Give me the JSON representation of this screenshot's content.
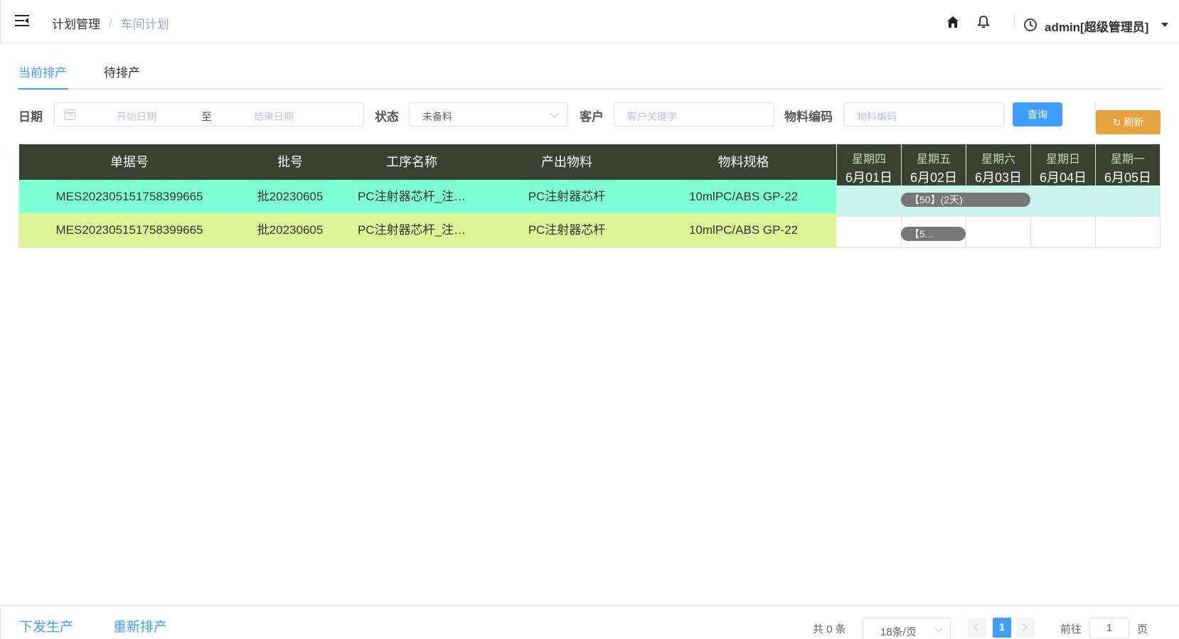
{
  "header": {
    "breadcrumb": [
      "计划管理",
      "车间计划"
    ],
    "separator": "/",
    "username": "admin[超级管理员]"
  },
  "tabs": [
    "当前排产",
    "待排产"
  ],
  "filters": {
    "date_label": "日期",
    "start_placeholder": "开始日期",
    "range_separator": "至",
    "end_placeholder": "结束日期",
    "status_label": "状态",
    "status_value": "未备料",
    "customer_label": "客户",
    "customer_placeholder": "客户关键字",
    "material_label": "物料编码",
    "material_placeholder": "物料编码",
    "query_button": "查询",
    "refresh_button": "刷新"
  },
  "table": {
    "columns": [
      "单据号",
      "批号",
      "工序名称",
      "产出物料",
      "物料规格"
    ],
    "rows": [
      [
        "MES202305151758399665",
        "批20230605",
        "PC注射器芯杆_注…",
        "PC注射器芯杆",
        "10mlPC/ABS GP-22"
      ],
      [
        "MES202305151758399665",
        "批20230605",
        "PC注射器芯杆_注…",
        "PC注射器芯杆",
        "10mlPC/ABS GP-22"
      ]
    ],
    "row_colors": [
      "#7fffd4",
      "#dff595"
    ]
  },
  "gantt": {
    "days": [
      {
        "weekday": "星期四",
        "date": "6月01日"
      },
      {
        "weekday": "星期五",
        "date": "6月02日"
      },
      {
        "weekday": "星期六",
        "date": "6月03日"
      },
      {
        "weekday": "星期日",
        "date": "6月04日"
      },
      {
        "weekday": "星期一",
        "date": "6月05日"
      }
    ],
    "bars": [
      "【50】(2天)",
      "【5..."
    ]
  },
  "footer": {
    "action1": "下发生产",
    "action2": "重新排产",
    "total": "共 0 条",
    "page_size": "18条/页",
    "current_page": "1",
    "goto_label": "前往",
    "goto_value": "1",
    "page_unit": "页"
  },
  "colors": {
    "primary": "#409eff",
    "warning": "#e6a23c",
    "table_header": "#3a4130"
  }
}
